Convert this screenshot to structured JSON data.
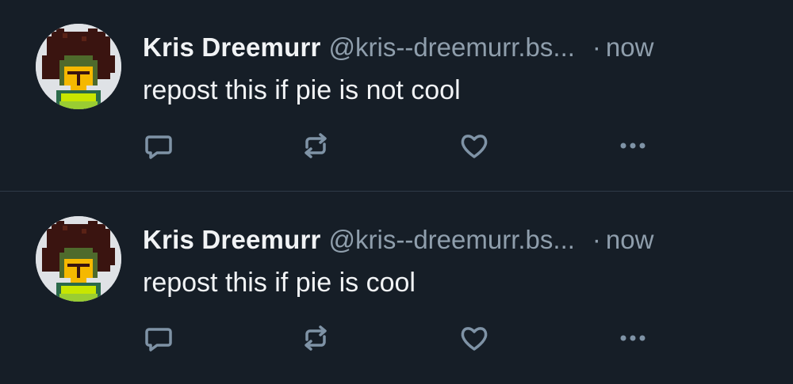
{
  "posts": [
    {
      "author": {
        "display_name": "Kris Dreemurr",
        "handle": "@kris--dreemurr.bs...",
        "avatar_icon": "pixel-avatar-kris"
      },
      "separator": "·",
      "timestamp": "now",
      "text": "repost this if pie is not cool",
      "actions": [
        "reply-icon",
        "repost-icon",
        "like-icon",
        "more-icon"
      ]
    },
    {
      "author": {
        "display_name": "Kris Dreemurr",
        "handle": "@kris--dreemurr.bs...",
        "avatar_icon": "pixel-avatar-kris"
      },
      "separator": "·",
      "timestamp": "now",
      "text": "repost this if pie is cool",
      "actions": [
        "reply-icon",
        "repost-icon",
        "like-icon",
        "more-icon"
      ]
    }
  ],
  "colors": {
    "background": "#161e27",
    "text_primary": "#f1f3f5",
    "text_secondary": "#8f9eac",
    "icon": "#7f93a6",
    "divider": "#2e3a47"
  }
}
